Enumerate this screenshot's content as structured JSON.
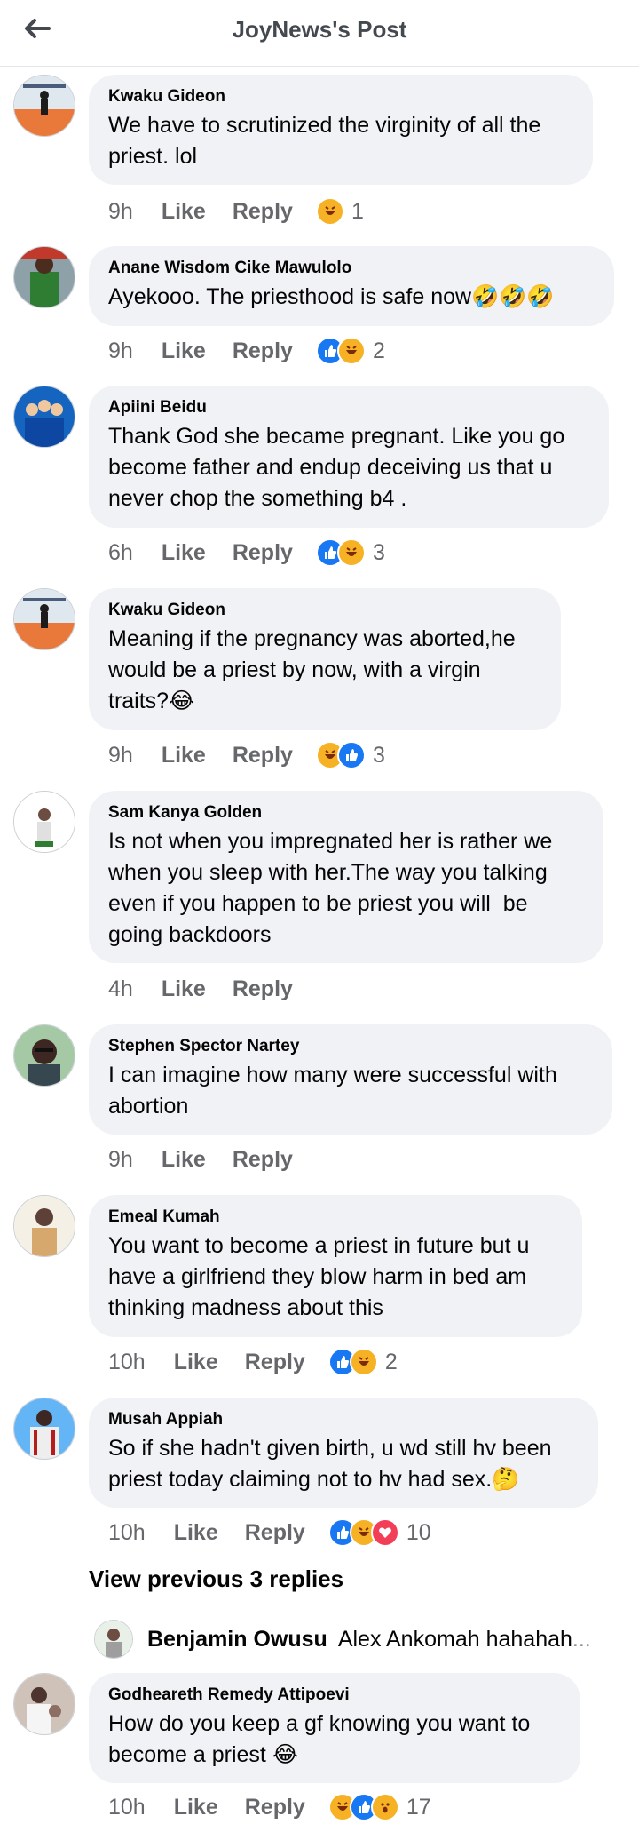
{
  "header": {
    "title": "JoyNews's Post",
    "back_icon": "arrow-left-icon"
  },
  "colors": {
    "like_blue": "#1877f2",
    "haha_yellow": "#f7b125",
    "love_red": "#f33e58",
    "bubble_bg": "#f0f2f5",
    "meta_gray": "#65676b"
  },
  "actions": {
    "like": "Like",
    "reply": "Reply"
  },
  "comments": [
    {
      "author": "Kwaku Gideon",
      "text": "We have to scrutinized the virginity of all the priest. lol",
      "time": "9h",
      "reactions": [
        "haha"
      ],
      "reaction_count": "1"
    },
    {
      "author": "Anane Wisdom Cike Mawulolo",
      "text": "Ayekooo. The priesthood is safe now🤣🤣🤣",
      "time": "9h",
      "reactions": [
        "like",
        "haha"
      ],
      "reaction_count": "2"
    },
    {
      "author": "Apiini Beidu",
      "text": "Thank God she became pregnant. Like you go become father and endup deceiving us that u never chop the something b4 .",
      "time": "6h",
      "reactions": [
        "like",
        "haha"
      ],
      "reaction_count": "3"
    },
    {
      "author": "Kwaku Gideon",
      "text": "Meaning if the pregnancy was aborted,he would be a priest by now, with a virgin traits?😂",
      "time": "9h",
      "reactions": [
        "haha",
        "like"
      ],
      "reaction_count": "3"
    },
    {
      "author": "Sam Kanya Golden",
      "text": "Is not when you impregnated her is rather we when you sleep with her.The way you talking even if you happen to be priest you will  be going backdoors",
      "time": "4h",
      "reactions": [],
      "reaction_count": ""
    },
    {
      "author": "Stephen Spector Nartey",
      "text": "I can imagine how many were successful with abortion",
      "time": "9h",
      "reactions": [],
      "reaction_count": ""
    },
    {
      "author": "Emeal Kumah",
      "text": "You want to become a priest in future but u have a girlfriend they blow harm in bed am thinking madness about this",
      "time": "10h",
      "reactions": [
        "like",
        "haha"
      ],
      "reaction_count": "2"
    },
    {
      "author": "Musah Appiah",
      "text": "So if she hadn't given birth, u wd still hv been priest today claiming not to hv had sex.🤔",
      "time": "10h",
      "reactions": [
        "like",
        "haha",
        "love"
      ],
      "reaction_count": "10"
    },
    {
      "author": "Godheareth Remedy Attipoevi",
      "text": "How do you keep a gf knowing you want to become a priest 😂",
      "time": "10h",
      "reactions": [
        "haha",
        "like",
        "wow"
      ],
      "reaction_count": "17"
    }
  ],
  "view_previous": "View previous 3 replies",
  "reply_preview": {
    "author": "Benjamin Owusu",
    "text": "Alex Ankomah hahahah",
    "ellipsis": "..."
  }
}
